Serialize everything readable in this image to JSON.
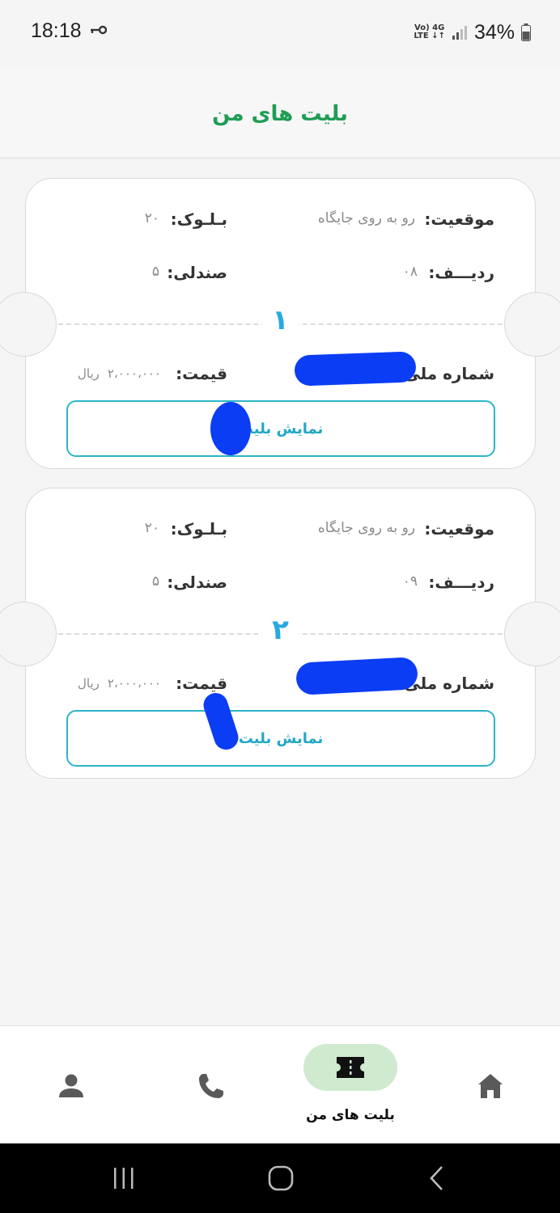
{
  "status_bar": {
    "time": "18:18",
    "battery": "34%",
    "net_top": "Vo) 4G",
    "net_bottom": "LTE ↓↑"
  },
  "header": {
    "title": "بلیت های من"
  },
  "tickets": [
    {
      "index": "۱",
      "location_label": "موقعیت:",
      "location_value": "رو به روی جایگاه",
      "block_label": "بـلـوک:",
      "block_value": "۲۰",
      "row_label": "ردیـــف:",
      "row_value": "۰۸",
      "seat_label": "صندلی:",
      "seat_value": "۵",
      "national_id_label": "شماره ملی",
      "price_label": "قیمت:",
      "price_value": "۲،۰۰۰،۰۰۰",
      "currency": "ریال",
      "button_label": "نمایش بلیت"
    },
    {
      "index": "۲",
      "location_label": "موقعیت:",
      "location_value": "رو به روی جایگاه",
      "block_label": "بـلـوک:",
      "block_value": "۲۰",
      "row_label": "ردیـــف:",
      "row_value": "۰۹",
      "seat_label": "صندلی:",
      "seat_value": "۵",
      "national_id_label": "شماره ملی",
      "price_label": "قیمت:",
      "price_value": "۲،۰۰۰،۰۰۰",
      "currency": "ریال",
      "button_label": "نمایش بلیت"
    }
  ],
  "bottom_nav": {
    "active_label": "بلیت های من",
    "items": [
      "home-icon",
      "ticket-icon",
      "phone-icon",
      "profile-icon"
    ]
  },
  "colors": {
    "accent_green": "#1f9d55",
    "accent_blue": "#29a9e0",
    "pill_bg": "#cfeacf"
  }
}
